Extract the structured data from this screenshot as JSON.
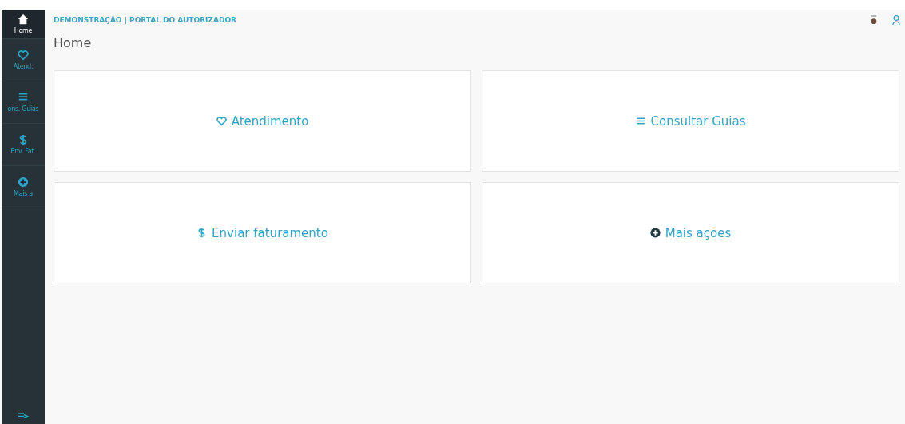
{
  "sidebar": {
    "items": [
      {
        "kind": "home",
        "label": "Home",
        "selected": true
      },
      {
        "kind": "heart",
        "label": "Atend.",
        "selected": false
      },
      {
        "kind": "list",
        "label": "ons. Guias",
        "selected": false
      },
      {
        "kind": "dollar",
        "label": "Env. Fat.",
        "selected": false
      },
      {
        "kind": "plus",
        "label": "Mais a",
        "selected": false
      }
    ]
  },
  "header": {
    "title": "DEMONSTRAÇÃO | PORTAL DO AUTORIZADOR"
  },
  "page_title": "Home",
  "cards": [
    {
      "kind": "heart",
      "label": "Atendimento"
    },
    {
      "kind": "list",
      "label": "Consultar Guias"
    },
    {
      "kind": "dollar",
      "label": "Enviar faturamento"
    },
    {
      "kind": "plus",
      "label": "Mais ações"
    }
  ]
}
